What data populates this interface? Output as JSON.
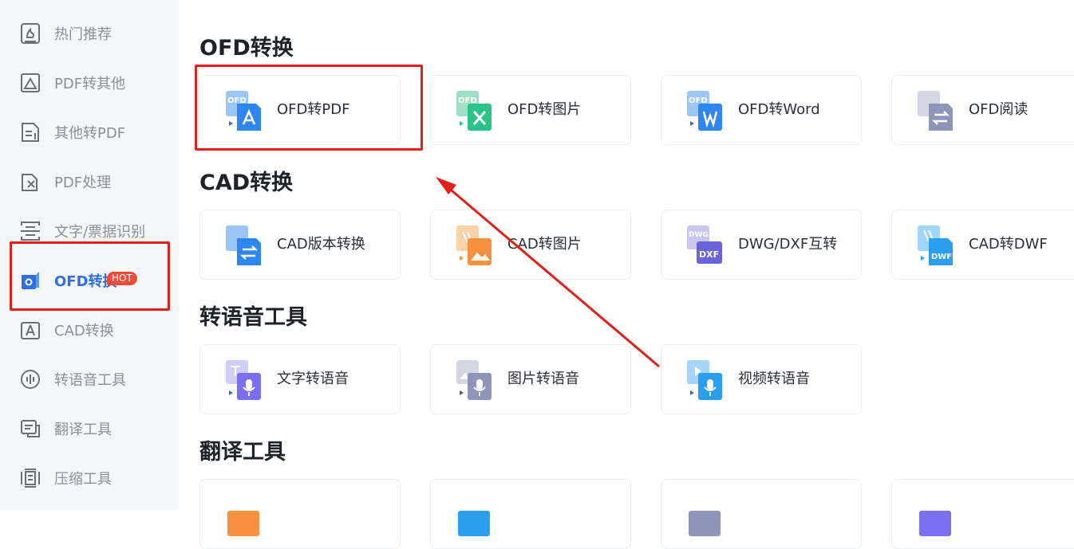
{
  "sidebar": {
    "items": [
      {
        "label": "热门推荐",
        "icon": "fire-icon"
      },
      {
        "label": "PDF转其他",
        "icon": "image-file-icon"
      },
      {
        "label": "其他转PDF",
        "icon": "document-icon"
      },
      {
        "label": "PDF处理",
        "icon": "edit-file-icon"
      },
      {
        "label": "文字/票据识别",
        "icon": "scan-icon"
      },
      {
        "label": "OFD转换",
        "icon": "ofd-icon",
        "badge": "HOT"
      },
      {
        "label": "CAD转换",
        "icon": "cad-icon"
      },
      {
        "label": "转语音工具",
        "icon": "audio-icon"
      },
      {
        "label": "翻译工具",
        "icon": "translate-icon"
      },
      {
        "label": "压缩工具",
        "icon": "compress-icon"
      }
    ]
  },
  "sections": [
    {
      "title": "OFD转换",
      "cards": [
        {
          "label": "OFD转PDF"
        },
        {
          "label": "OFD转图片"
        },
        {
          "label": "OFD转Word"
        },
        {
          "label": "OFD阅读"
        }
      ]
    },
    {
      "title": "CAD转换",
      "cards": [
        {
          "label": "CAD版本转换"
        },
        {
          "label": "CAD转图片"
        },
        {
          "label": "DWG/DXF互转"
        },
        {
          "label": "CAD转DWF"
        }
      ]
    },
    {
      "title": "转语音工具",
      "cards": [
        {
          "label": "文字转语音"
        },
        {
          "label": "图片转语音"
        },
        {
          "label": "视频转语音"
        }
      ]
    },
    {
      "title": "翻译工具",
      "cards": [
        {
          "label": ""
        },
        {
          "label": ""
        },
        {
          "label": ""
        },
        {
          "label": ""
        }
      ]
    }
  ],
  "icon_texts": {
    "ofd": "OFD",
    "dwg": "DWG",
    "dxf": "DXF",
    "dwf": "DWF"
  },
  "colors": {
    "accent": "#2f6fe0",
    "highlight": "#e0201a",
    "hot": "#ef4a3a"
  }
}
